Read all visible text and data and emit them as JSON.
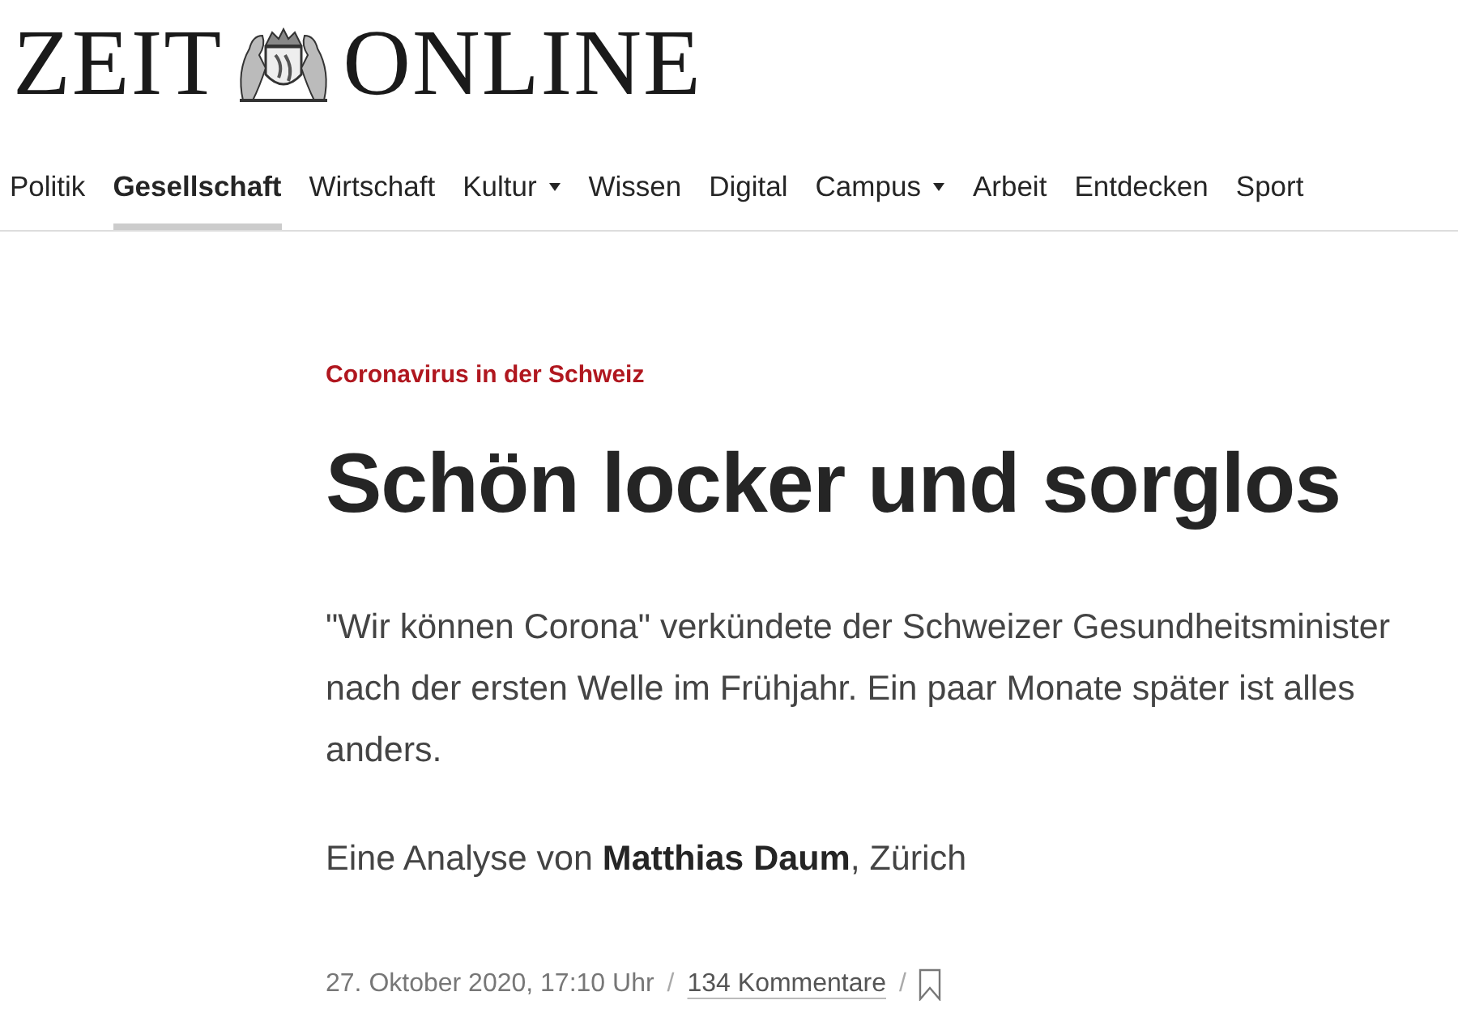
{
  "logo": {
    "left": "ZEIT",
    "right": "ONLINE"
  },
  "nav": [
    {
      "label": "Politik",
      "selected": false,
      "dropdown": false
    },
    {
      "label": "Gesellschaft",
      "selected": true,
      "dropdown": false
    },
    {
      "label": "Wirtschaft",
      "selected": false,
      "dropdown": false
    },
    {
      "label": "Kultur",
      "selected": false,
      "dropdown": true
    },
    {
      "label": "Wissen",
      "selected": false,
      "dropdown": false
    },
    {
      "label": "Digital",
      "selected": false,
      "dropdown": false
    },
    {
      "label": "Campus",
      "selected": false,
      "dropdown": true
    },
    {
      "label": "Arbeit",
      "selected": false,
      "dropdown": false
    },
    {
      "label": "Entdecken",
      "selected": false,
      "dropdown": false
    },
    {
      "label": "Sport",
      "selected": false,
      "dropdown": false
    }
  ],
  "article": {
    "kicker": "Coronavirus in der Schweiz",
    "headline": "Schön locker und sorglos",
    "summary": "\"Wir können Corona\" verkündete der Schweizer Gesundheitsminister nach der ersten Welle im Frühjahr. Ein paar Monate später ist alles anders.",
    "byline": "Eine Analyse von **Matthias Daum**, Zürich",
    "date": "27. Oktober 2020, 17:10 Uhr",
    "separator_1": "/",
    "comments": "134 Kommentare",
    "separator_2": "/"
  }
}
